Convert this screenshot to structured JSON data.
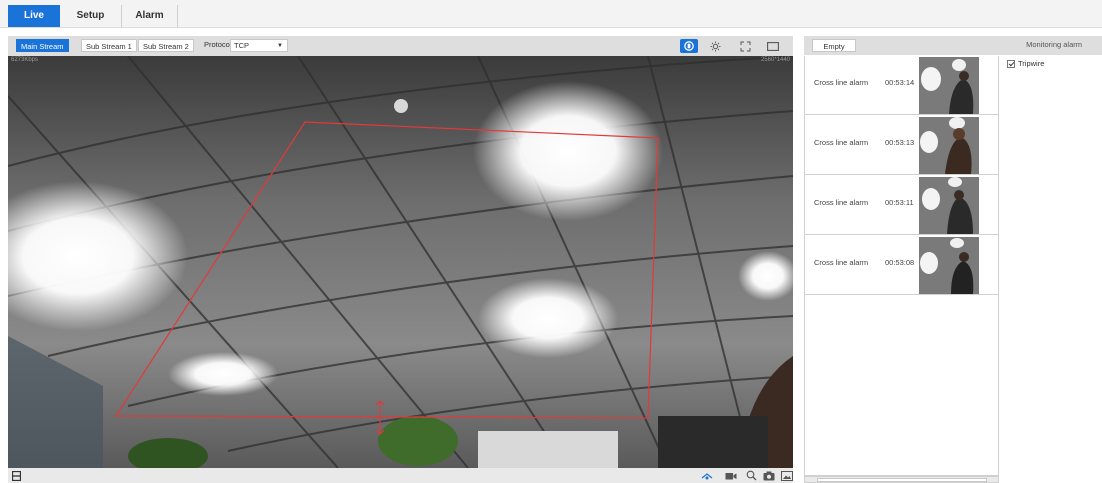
{
  "nav": {
    "tabs": [
      {
        "label": "Live",
        "active": true
      },
      {
        "label": "Setup",
        "active": false
      },
      {
        "label": "Alarm",
        "active": false
      }
    ]
  },
  "toolbar": {
    "streams": [
      {
        "label": "Main Stream",
        "active": true
      },
      {
        "label": "Sub Stream 1",
        "active": false
      },
      {
        "label": "Sub Stream 2",
        "active": false
      }
    ],
    "protocol_label": "Protocol",
    "protocol_value": "TCP",
    "icons": [
      "record-indicator-icon",
      "brightness-icon",
      "fullscreen-icon",
      "window-icon"
    ]
  },
  "video": {
    "bitrate": "6273Kbps",
    "resolution": "2560*1440",
    "overlay_color": "#e03a3a"
  },
  "bottom_bar": {
    "left_icon": "stream-info-icon",
    "right_icons": [
      "ptz-icon",
      "record-icon",
      "zoom-icon",
      "snapshot-icon",
      "image-icon"
    ]
  },
  "alarm_panel": {
    "empty_label": "Empty",
    "title": "Monitoring alarm",
    "alarms": [
      {
        "type": "Cross line alarm",
        "time": "00:53:14"
      },
      {
        "type": "Cross line alarm",
        "time": "00:53:13"
      },
      {
        "type": "Cross line alarm",
        "time": "00:53:11"
      },
      {
        "type": "Cross line alarm",
        "time": "00:53:08"
      }
    ],
    "filters": [
      {
        "label": "Tripwire",
        "checked": true
      }
    ]
  },
  "colors": {
    "accent": "#1a73d9",
    "toolbar_bg": "#dedede"
  }
}
